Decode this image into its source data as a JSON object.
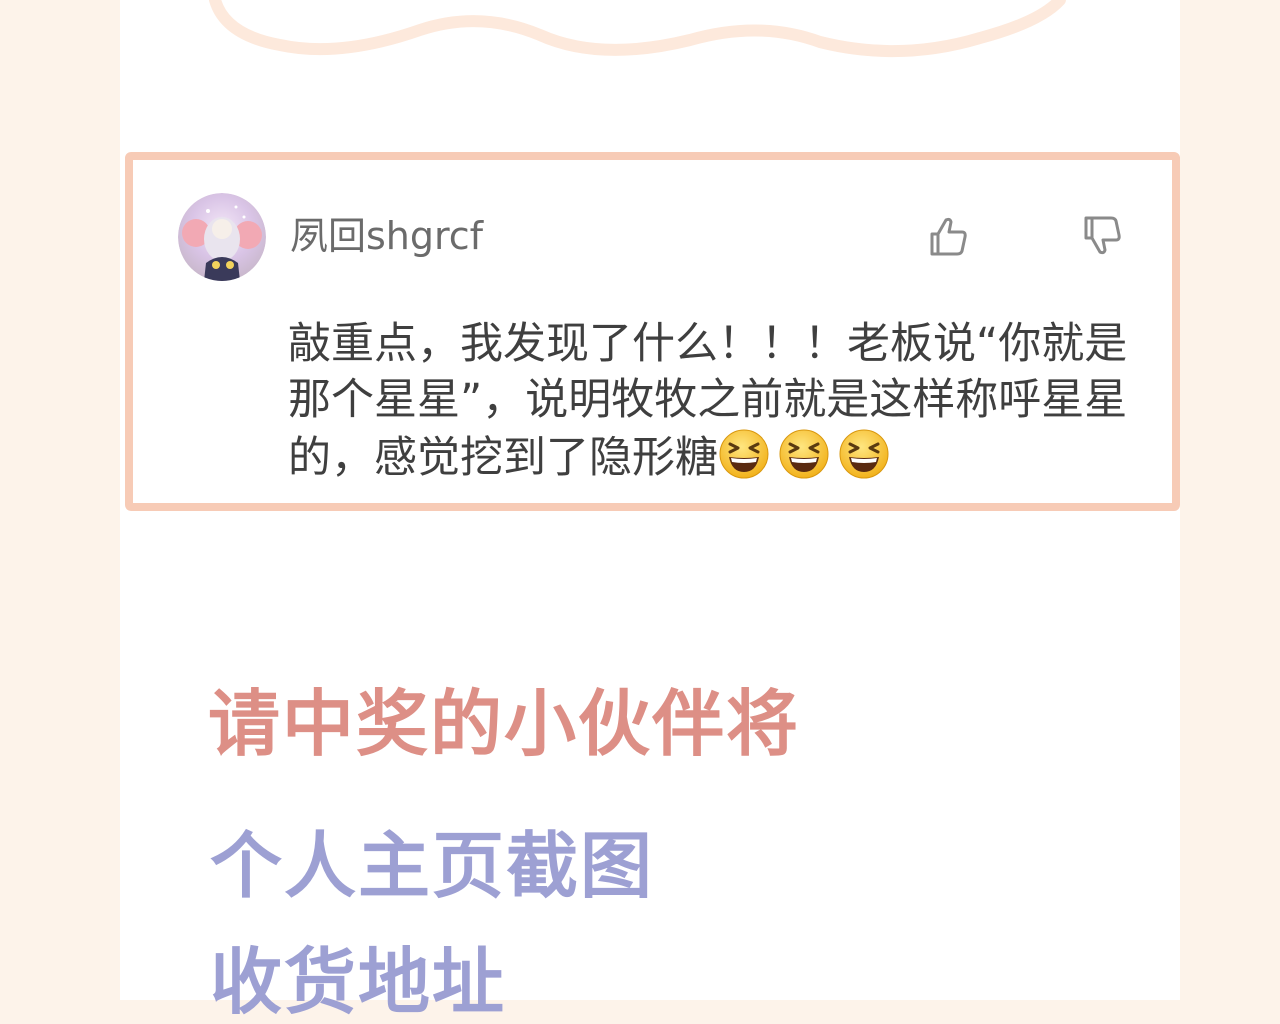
{
  "comment": {
    "username": "夙回shgrcf",
    "text": "敲重点，我发现了什么！！！老板说“你就是那个星星”，说明牧牧之前就是这样称呼星星的，感觉挖到了隐形糖",
    "emoji_count": 3
  },
  "announcement": {
    "winners_line": "请中奖的小伙伴将",
    "profile_line": "个人主页截图",
    "address_line": "收货地址"
  },
  "colors": {
    "background": "#fdf3ea",
    "card_border": "#f7cbb6",
    "winners_text": "#dd8f86",
    "profile_text": "#9da0d3",
    "username_text": "#6b6b6b",
    "comment_text": "#3f3f3f"
  },
  "icons": {
    "like": "thumbs-up-icon",
    "dislike": "thumbs-down-icon",
    "emoji": "grinning-squinting-face-icon"
  }
}
